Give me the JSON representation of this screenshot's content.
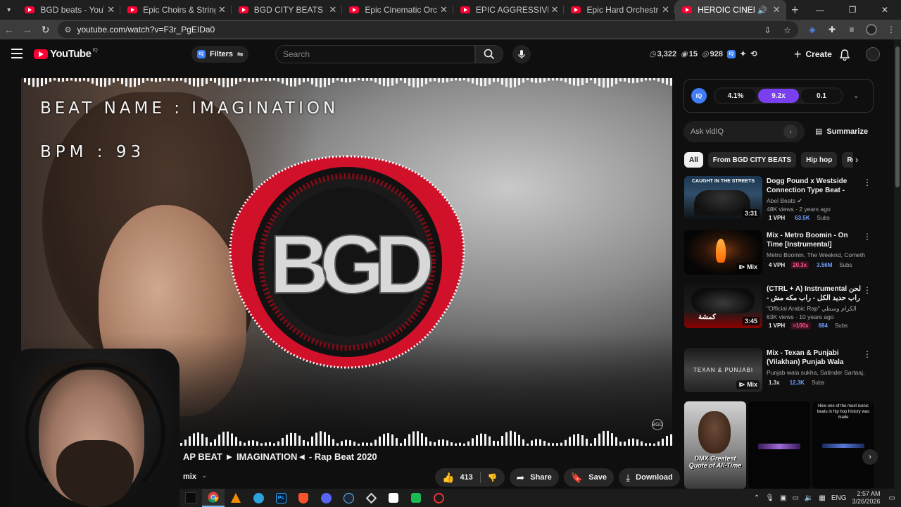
{
  "browser": {
    "tabs": [
      {
        "title": "BGD beats - YouTube",
        "active": false
      },
      {
        "title": "Epic Choirs & Strings - Orchestral",
        "active": false
      },
      {
        "title": "BGD CITY BEATS - YouTube",
        "active": false
      },
      {
        "title": "Epic Cinematic Orchestral Oud",
        "active": false
      },
      {
        "title": "EPIC AGGRESSIVE ORCHESTRAL",
        "active": false
      },
      {
        "title": "Epic Hard Orchestral Rap Instru",
        "active": false
      },
      {
        "title": "HEROIC CINEMATIC - ORCH",
        "active": true
      }
    ],
    "url": "youtube.com/watch?v=F3r_PgEIDa0"
  },
  "header": {
    "logo_word": "YouTube",
    "region": "IQ",
    "filters_label": "Filters",
    "search_placeholder": "Search",
    "stats": {
      "views": "3,322",
      "a": "15",
      "b": "928"
    },
    "create_label": "Create"
  },
  "video": {
    "overlay_beat_name": "BEAT NAME : IMAGINATION",
    "overlay_bpm": "BPM : 93",
    "logo_text": "BGD",
    "title_visible": "AP BEAT ► IMAGINATION◄ - Rap Beat 2020",
    "channel_fragment": "mix",
    "likes": "413",
    "share_label": "Share",
    "save_label": "Save",
    "download_label": "Download"
  },
  "vidiq": {
    "badge": "IQ",
    "metrics": [
      "4.1%",
      "9.2x",
      "0.1"
    ],
    "ask_placeholder": "Ask vidIQ",
    "summarize_label": "Summarize"
  },
  "chips": [
    "All",
    "From BGD CITY BEATS",
    "Hip hop",
    "Relat"
  ],
  "recommendations": [
    {
      "title": "Dogg Pound x Westside Connection Type Beat - Caught...",
      "channel": "Abel Beats",
      "meta": "48K views · 2 years ago",
      "duration": "3:31",
      "vph": "1 VPH",
      "multiplier": "",
      "subs": "63.5K",
      "thumb_text": "CAUGHT IN THE STREETS"
    },
    {
      "title": "Mix - Metro Boomin - On Time [Instrumental]",
      "channel": "Metro Boomin, The Weeknd, Comethazine,...",
      "meta": "",
      "duration": "Mix",
      "vph": "4 VPH",
      "multiplier": "20.3x",
      "subs": "3.56M"
    },
    {
      "title": "(CTRL + A) Instrumental لحن راب حديد الكل - راب مكه مش - شيريه",
      "channel": "\"Official Arabic Rap\" الكرام وسطي",
      "meta": "63K views · 10 years ago",
      "duration": "3:45",
      "vph": "1 VPH",
      "multiplier": ">100x",
      "subs": "684",
      "thumb_text": "كمشة"
    },
    {
      "title": "Mix - Texan & Punjabi (Vilakhan) Punjab Wala Sukha ...",
      "channel": "Punjab wala sukha, Satinder Sartaaj, Abh...",
      "meta": "",
      "duration": "Mix",
      "vph": "",
      "multiplier": "1.3x",
      "subs": "12.3K",
      "thumb_text": "TEXAN & PUNJABI"
    }
  ],
  "subs_word": "Subs",
  "shorts": [
    {
      "caption": "DMX Greatest Quote of All-Time"
    },
    {
      "caption": ""
    },
    {
      "caption": "How one of the most iconic beats in hip hop history was made"
    }
  ],
  "taskbar": {
    "lang": "ENG",
    "time": "2:57 AM",
    "date": "3/26/2026"
  },
  "colors": {
    "accent_red": "#ff0033",
    "vidiq_purple": "#7b3ff2",
    "vidiq_blue": "#3f7ef7"
  }
}
